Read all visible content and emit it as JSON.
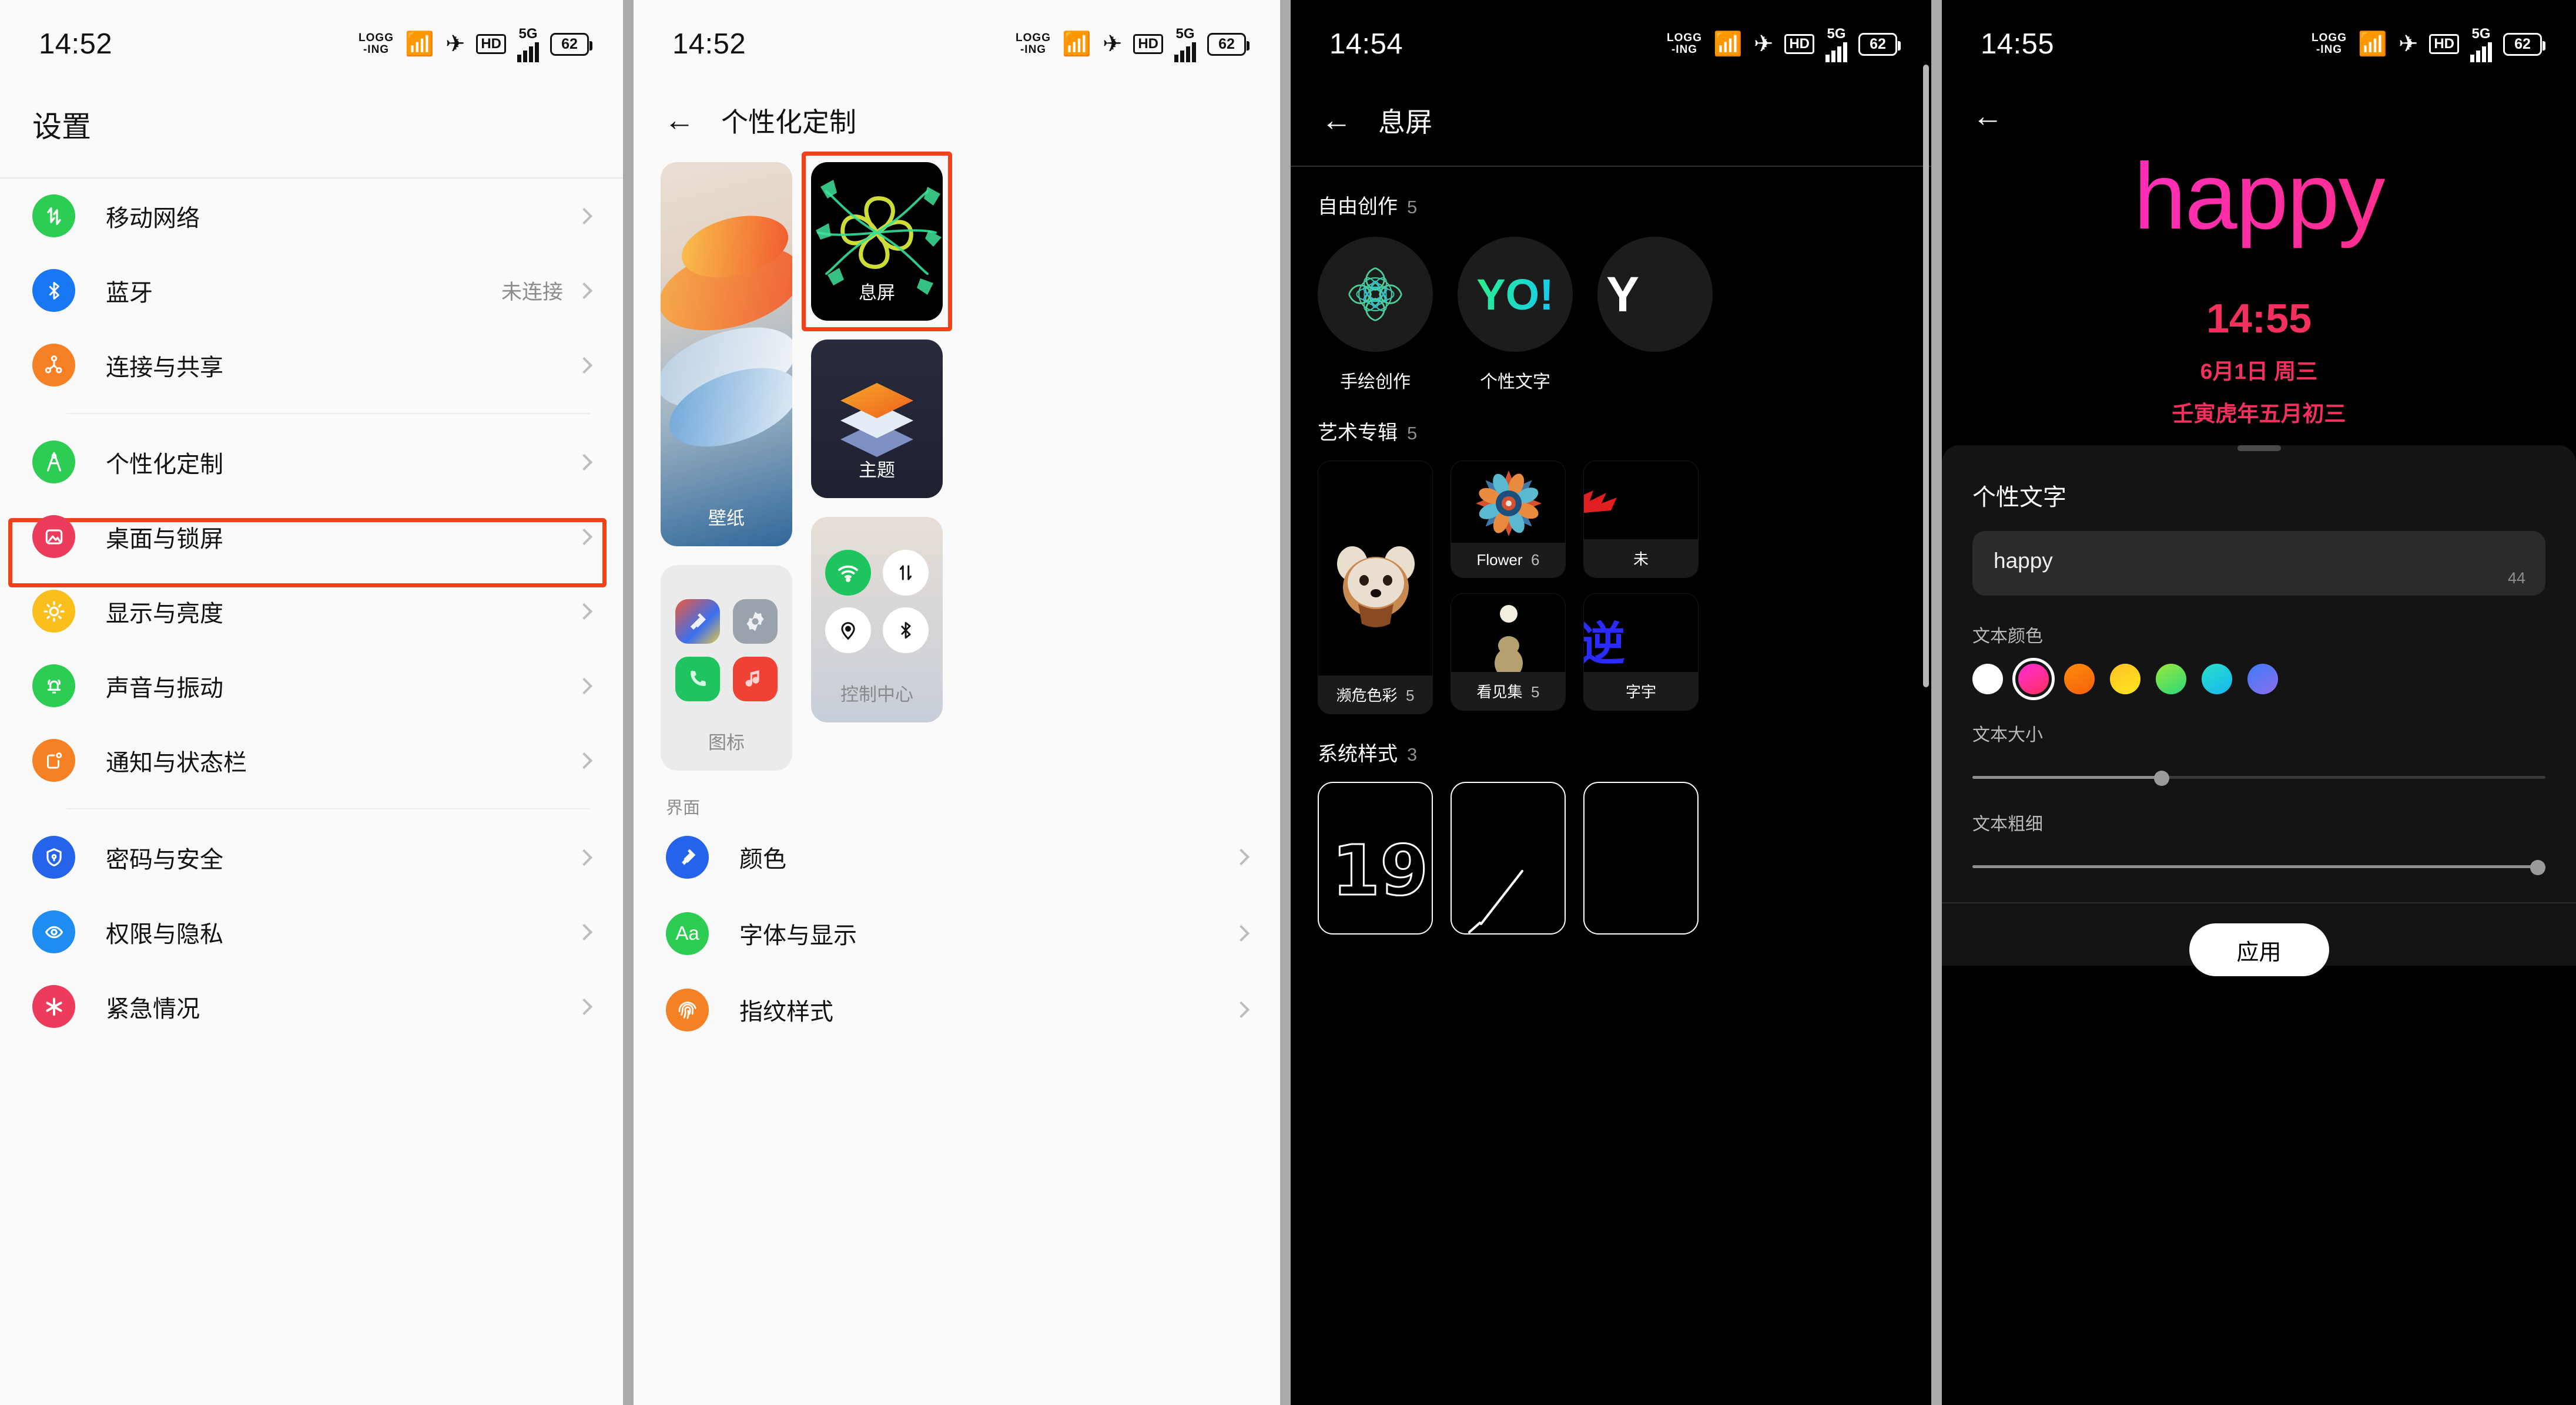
{
  "statusbar": {
    "logging": "LOGG\n-ING",
    "logging_line1": "LOGG",
    "logging_line2": "-ING",
    "hd": "HD",
    "net": "5G",
    "battery": "62",
    "bluetooth_icon": "bluetooth-icon",
    "wifi_icon": "wifi-icon",
    "signal_icon": "signal-bars-icon"
  },
  "panel1": {
    "time": "14:52",
    "title": "设置",
    "items": [
      {
        "label": "移动网络",
        "value": "",
        "icon": "mobile-network-icon",
        "color": "#2dcc52"
      },
      {
        "label": "蓝牙",
        "value": "未连接",
        "icon": "bluetooth-icon",
        "color": "#1877f2"
      },
      {
        "label": "连接与共享",
        "value": "",
        "icon": "connect-share-icon",
        "color": "#f68024"
      },
      {
        "label": "个性化定制",
        "value": "",
        "icon": "personalization-icon",
        "color": "#2dcc52"
      },
      {
        "label": "桌面与锁屏",
        "value": "",
        "icon": "wallpaper-lockscreen-icon",
        "color": "#ec3b5b"
      },
      {
        "label": "显示与亮度",
        "value": "",
        "icon": "brightness-icon",
        "color": "#fbbf1d"
      },
      {
        "label": "声音与振动",
        "value": "",
        "icon": "sound-vibration-icon",
        "color": "#2dcc52"
      },
      {
        "label": "通知与状态栏",
        "value": "",
        "icon": "notification-icon",
        "color": "#f68024"
      },
      {
        "label": "密码与安全",
        "value": "",
        "icon": "security-shield-icon",
        "color": "#2563eb"
      },
      {
        "label": "权限与隐私",
        "value": "",
        "icon": "privacy-icon",
        "color": "#1f8cf2"
      },
      {
        "label": "紧急情况",
        "value": "",
        "icon": "emergency-icon",
        "color": "#ec3b5b"
      }
    ],
    "highlighted_item": "个性化定制",
    "highlight_color": "#f4411a"
  },
  "panel2": {
    "time": "14:52",
    "title": "个性化定制",
    "back_icon": "back-arrow-icon",
    "cards": [
      {
        "label": "壁纸",
        "name": "wallpaper-card"
      },
      {
        "label": "息屏",
        "name": "aod-card",
        "highlighted": true
      },
      {
        "label": "主题",
        "name": "theme-card"
      },
      {
        "label": "图标",
        "name": "icons-card"
      },
      {
        "label": "控制中心",
        "name": "control-center-card"
      }
    ],
    "section_label": "界面",
    "list": [
      {
        "label": "颜色",
        "icon": "color-icon",
        "color": "#2563eb"
      },
      {
        "label": "字体与显示",
        "icon": "font-icon",
        "color": "#2dcc52",
        "glyph": "Aa"
      },
      {
        "label": "指纹样式",
        "icon": "fingerprint-icon",
        "color": "#f68024"
      }
    ]
  },
  "panel3": {
    "time": "14:54",
    "title": "息屏",
    "back_icon": "back-arrow-icon",
    "sections": [
      {
        "title": "自由创作",
        "count": "5",
        "items": [
          {
            "label": "手绘创作",
            "name": "handdraw-item"
          },
          {
            "label": "个性文字",
            "name": "custom-text-item",
            "preview": "YO!"
          },
          {
            "label": "",
            "name": "partial-item",
            "preview": "Y"
          }
        ]
      },
      {
        "title": "艺术专辑",
        "count": "5",
        "cards": [
          {
            "label": "濒危色彩",
            "count": "5",
            "name": "endangered-colors-card"
          },
          {
            "label": "Flower",
            "count": "6",
            "name": "flower-card"
          },
          {
            "label": "未",
            "count": "",
            "name": "partial-card-1"
          },
          {
            "label": "看见集",
            "count": "5",
            "name": "seen-collection-card"
          },
          {
            "label": "字宇",
            "count": "",
            "name": "partial-card-2"
          }
        ]
      },
      {
        "title": "系统样式",
        "count": "3",
        "cards": [
          {
            "label": "",
            "name": "sys-style-1"
          },
          {
            "label": "",
            "name": "sys-style-2"
          },
          {
            "label": "",
            "name": "sys-style-3"
          }
        ]
      }
    ]
  },
  "panel4": {
    "time": "14:55",
    "back_icon": "back-arrow-icon",
    "preview_text": "happy",
    "aod_clock": "14:55",
    "aod_date": "6月1日 周三",
    "aod_lunar": "壬寅虎年五月初三",
    "sheet_title": "个性文字",
    "input_value": "happy",
    "input_counter": "44",
    "color_label": "文本颜色",
    "colors": [
      {
        "hex": "#ffffff",
        "name": "white",
        "selected": false
      },
      {
        "hex": "#ff2ed8",
        "name": "magenta",
        "selected": true
      },
      {
        "hex": "#ff7a10",
        "name": "orange",
        "selected": false
      },
      {
        "hex": "#ffc928",
        "name": "yellow",
        "selected": false
      },
      {
        "hex": "#6fe04a",
        "name": "green",
        "selected": false
      },
      {
        "hex": "#1fd6d6",
        "name": "cyan",
        "selected": false
      },
      {
        "hex": "#4f7bf5",
        "name": "blue",
        "selected": false
      }
    ],
    "size_label": "文本大小",
    "size_value": 33,
    "weight_label": "文本粗细",
    "weight_value": 99,
    "apply_label": "应用"
  }
}
